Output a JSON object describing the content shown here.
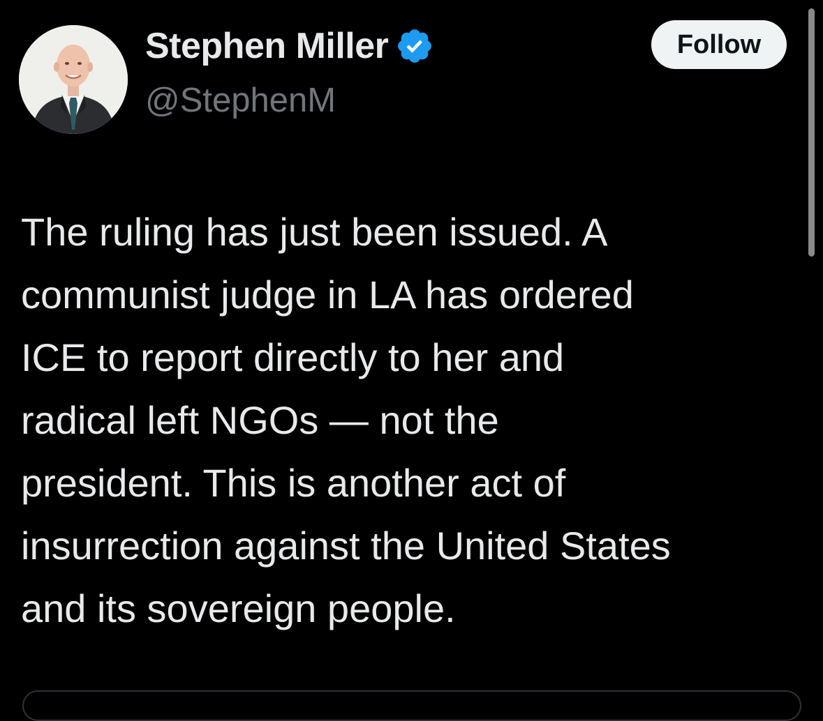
{
  "author": {
    "display_name": "Stephen Miller",
    "handle": "@StephenM",
    "verified_icon": "verified-badge-icon",
    "avatar_icon": "profile-photo"
  },
  "actions": {
    "follow_label": "Follow"
  },
  "tweet": {
    "text": "The ruling has just been issued. A\ncommunist judge in LA has ordered\nICE to report directly to her and\nradical left NGOs — not the\npresident. This is another act of\ninsurrection against the United States\nand its sovereign people."
  },
  "colors": {
    "background": "#000000",
    "primary_text": "#e7e9ea",
    "secondary_text": "#71767b",
    "verified_blue": "#1d9bf0",
    "follow_bg": "#eff3f4",
    "follow_text": "#0f1419"
  }
}
